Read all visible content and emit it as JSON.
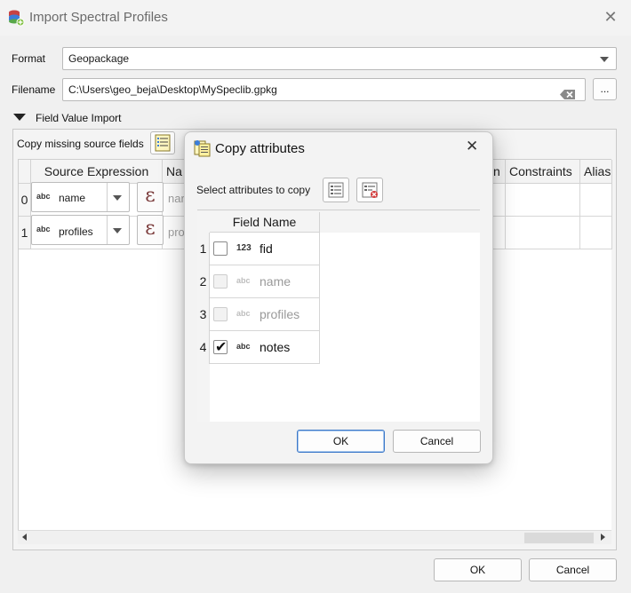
{
  "window": {
    "title": "Import Spectral Profiles"
  },
  "format": {
    "label": "Format",
    "value": "Geopackage"
  },
  "filename": {
    "label": "Filename",
    "value": "C:\\Users\\geo_beja\\Desktop\\MySpeclib.gpkg",
    "browse_label": "..."
  },
  "field_import": {
    "title": "Field Value Import",
    "copy_missing_label": "Copy missing source fields",
    "headers": {
      "source_expression": "Source Expression",
      "name": "Na",
      "type": "n",
      "constraints": "Constraints",
      "alias": "Alias"
    },
    "rows": [
      {
        "num": "0",
        "type": "abc",
        "expression": "name",
        "name_preview": "nar"
      },
      {
        "num": "1",
        "type": "abc",
        "expression": "profiles",
        "name_preview": "pro"
      }
    ],
    "expr_symbol": "ε"
  },
  "footer": {
    "ok": "OK",
    "cancel": "Cancel"
  },
  "dialog": {
    "title": "Copy attributes",
    "select_label": "Select attributes to copy",
    "column_header": "Field Name",
    "fields": [
      {
        "num": "1",
        "type": "123",
        "name": "fid",
        "checked": false,
        "enabled": true
      },
      {
        "num": "2",
        "type": "abc",
        "name": "name",
        "checked": false,
        "enabled": false
      },
      {
        "num": "3",
        "type": "abc",
        "name": "profiles",
        "checked": false,
        "enabled": false
      },
      {
        "num": "4",
        "type": "abc",
        "name": "notes",
        "checked": true,
        "enabled": true
      }
    ],
    "ok": "OK",
    "cancel": "Cancel",
    "close_glyph": "✕"
  },
  "colors": {
    "accent": "#3c78c8",
    "window_bg": "#f0f0f0",
    "disabled_text": "#9a9a9a"
  }
}
